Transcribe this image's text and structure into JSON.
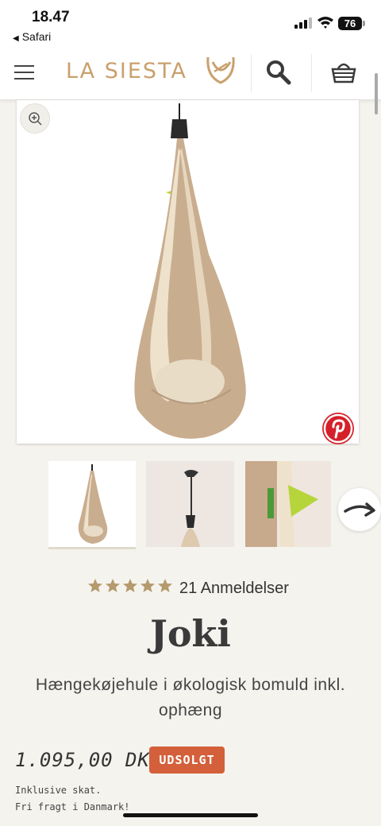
{
  "status_bar": {
    "time": "18.47",
    "back_app": "Safari",
    "battery": "76"
  },
  "header": {
    "logo_text": "LA SIESTA",
    "icons": [
      "menu-icon",
      "search-icon",
      "basket-icon"
    ]
  },
  "product": {
    "rating_stars": 5,
    "reviews_label": "21 Anmeldelser",
    "title": "Joki",
    "subtitle": "Hængekøjehule i økologisk bomuld inkl. ophæng",
    "price": "1.095,00 DKK",
    "badge": "UDSOLGT",
    "note_tax": "Inklusive skat.",
    "note_shipping": "Fri fragt i Danmark!"
  },
  "colors": {
    "brand": "#c9a06c",
    "sold_badge": "#d3603a",
    "star": "#b59a6e",
    "pinterest": "#d5202a"
  }
}
